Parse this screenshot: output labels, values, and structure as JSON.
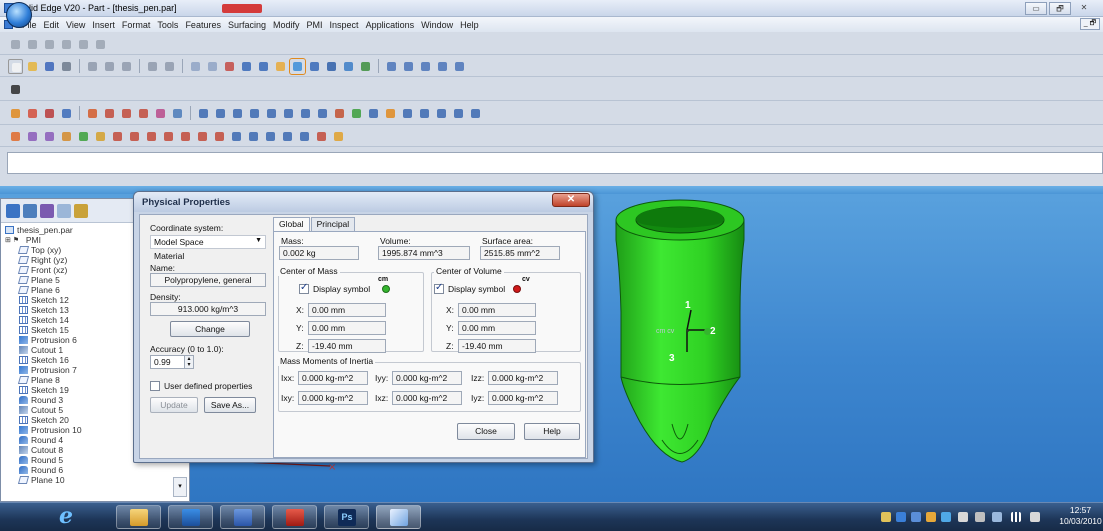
{
  "window": {
    "title": "Solid Edge V20 - Part - [thesis_pen.par]",
    "buttons": [
      "▭",
      "🗗",
      "✕"
    ]
  },
  "menubar": {
    "items": [
      "File",
      "Edit",
      "View",
      "Insert",
      "Format",
      "Tools",
      "Features",
      "Surfacing",
      "Modify",
      "PMI",
      "Inspect",
      "Applications",
      "Window",
      "Help"
    ]
  },
  "pathfinder": {
    "root": "thesis_pen.par",
    "items": [
      "PMI",
      "Top (xy)",
      "Right (yz)",
      "Front (xz)",
      "Plane 5",
      "Plane 6",
      "Sketch 12",
      "Sketch 13",
      "Sketch 14",
      "Sketch 15",
      "Protrusion 6",
      "Cutout 1",
      "Sketch 16",
      "Protrusion 7",
      "Plane 8",
      "Sketch 19",
      "Round 3",
      "Cutout 5",
      "Sketch 20",
      "Protrusion 10",
      "Round 4",
      "Cutout 8",
      "Round 5",
      "Round 6",
      "Plane 10"
    ]
  },
  "dialog": {
    "title": "Physical Properties",
    "close_glyph": "✕",
    "coord_label": "Coordinate system:",
    "coord_value": "Model Space",
    "material_label": "Material",
    "name_label": "Name:",
    "name_value": "Polypropylene, general",
    "density_label": "Density:",
    "density_value": "913.000 kg/m^3",
    "change_button": "Change",
    "accuracy_label": "Accuracy (0 to 1.0):",
    "accuracy_value": "0.99",
    "user_defined_label": "User defined properties",
    "update_button": "Update",
    "save_as_button": "Save As...",
    "tabs": [
      "Global",
      "Principal"
    ],
    "mass_label": "Mass:",
    "mass_value": "0.002 kg",
    "volume_label": "Volume:",
    "volume_value": "1995.874 mm^3",
    "surface_label": "Surface area:",
    "surface_value": "2515.85 mm^2",
    "com_group": "Center of Mass",
    "cov_group": "Center of Volume",
    "display_symbol": "Display symbol",
    "cm_symbol": "cm",
    "cv_symbol": "cv",
    "com": {
      "x_label": "X:",
      "x": "0.00 mm",
      "y_label": "Y:",
      "y": "0.00 mm",
      "z_label": "Z:",
      "z": "-19.40 mm"
    },
    "cov": {
      "x_label": "X:",
      "x": "0.00 mm",
      "y_label": "Y:",
      "y": "0.00 mm",
      "z_label": "Z:",
      "z": "-19.40 mm"
    },
    "inertia_group": "Mass Moments of Inertia",
    "inertia": {
      "ixx_label": "Ixx:",
      "ixx": "0.000 kg-m^2",
      "iyy_label": "Iyy:",
      "iyy": "0.000 kg-m^2",
      "izz_label": "Izz:",
      "izz": "0.000 kg-m^2",
      "ixy_label": "Ixy:",
      "ixy": "0.000 kg-m^2",
      "ixz_label": "Ixz:",
      "ixz": "0.000 kg-m^2",
      "iyz_label": "Iyz:",
      "iyz": "0.000 kg-m^2"
    },
    "close_button": "Close",
    "help_button": "Help"
  },
  "viewport": {
    "axis_labels": [
      "1",
      "2",
      "3"
    ],
    "origin_label": "cm cv"
  },
  "taskbar": {
    "clock_time": "12:57",
    "clock_date": "10/03/2010",
    "ps_label": "Ps"
  },
  "colors": {
    "part_green": "#2fd123",
    "viewport_blue": "#3d86cf",
    "cm_dot": "#35b52e",
    "cv_dot": "#d01919"
  }
}
